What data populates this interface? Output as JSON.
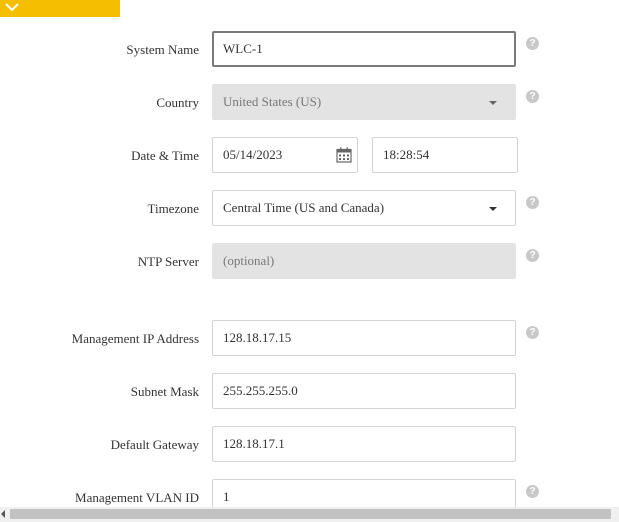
{
  "header": {
    "collapse_icon": "chevron-down-icon",
    "accent_color": "#f5bf00"
  },
  "form": {
    "system_name": {
      "label": "System Name",
      "value": "WLC-1"
    },
    "country": {
      "label": "Country",
      "value": "United States (US)"
    },
    "date_time": {
      "label": "Date & Time",
      "date": "05/14/2023",
      "time": "18:28:54"
    },
    "timezone": {
      "label": "Timezone",
      "value": "Central Time (US and Canada)"
    },
    "ntp_server": {
      "label": "NTP Server",
      "placeholder": "(optional)"
    },
    "mgmt_ip": {
      "label": "Management IP Address",
      "value": "128.18.17.15"
    },
    "subnet_mask": {
      "label": "Subnet Mask",
      "value": "255.255.255.0"
    },
    "default_gateway": {
      "label": "Default Gateway",
      "value": "128.18.17.1"
    },
    "mgmt_vlan": {
      "label": "Management VLAN ID",
      "value": "1"
    }
  },
  "help_glyph": "?"
}
